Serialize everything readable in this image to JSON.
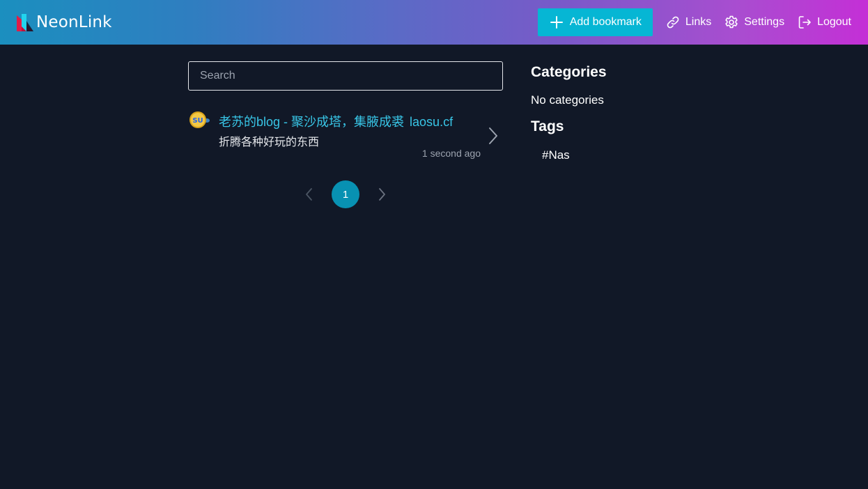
{
  "app": {
    "name": "NeonLink",
    "logo_icon": "neonlink-logo-icon"
  },
  "nav": {
    "add_bookmark": {
      "label": "Add bookmark",
      "icon": "plus-icon"
    },
    "links": {
      "label": "Links",
      "icon": "link-icon"
    },
    "settings": {
      "label": "Settings",
      "icon": "gear-icon"
    },
    "logout": {
      "label": "Logout",
      "icon": "logout-icon"
    }
  },
  "search": {
    "placeholder": "Search",
    "value": ""
  },
  "bookmarks": [
    {
      "title": "老苏的blog - 聚沙成塔，集腋成裘",
      "domain": "laosu.cf",
      "description": "折腾各种好玩的东西",
      "time": "1 second ago",
      "favicon_icon": "su-favicon-icon"
    }
  ],
  "pagination": {
    "current_page": "1",
    "prev_icon": "chevron-left-icon",
    "next_icon": "chevron-right-icon"
  },
  "sidebar": {
    "categories_heading": "Categories",
    "categories_empty": "No categories",
    "tags_heading": "Tags",
    "tags": [
      "#Nas"
    ]
  },
  "colors": {
    "background": "#111827",
    "accent": "#06b6d4",
    "link": "#38c5e6",
    "page_active": "#0891b2",
    "header_gradient_start": "#1b8fbf",
    "header_gradient_end": "#c42fd6"
  }
}
